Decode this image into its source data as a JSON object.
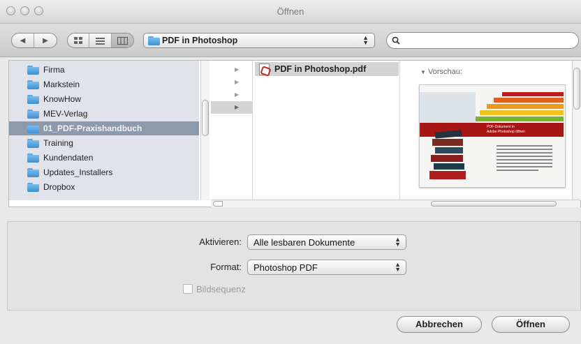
{
  "window": {
    "title": "Öffnen"
  },
  "toolbar": {
    "nav_back_icon": "◀",
    "nav_forward_icon": "▶",
    "location": "PDF in Photoshop",
    "search_placeholder": ""
  },
  "sidebar": {
    "items": [
      {
        "label": "Firma"
      },
      {
        "label": "Markstein"
      },
      {
        "label": "KnowHow"
      },
      {
        "label": "MEV-Verlag"
      },
      {
        "label": "01_PDF-Praxishandbuch",
        "selected": true
      },
      {
        "label": "Training"
      },
      {
        "label": "Kundendaten"
      },
      {
        "label": "Updates_Installers"
      },
      {
        "label": "Dropbox"
      }
    ]
  },
  "files": {
    "selected_file": "PDF in Photoshop.pdf",
    "preview_label": "Vorschau:",
    "preview_icon": "▼"
  },
  "thumb": {
    "line1": "PDF-Dokument in",
    "line2": "Adobe Photoshop öffnen"
  },
  "options": {
    "activate_label": "Aktivieren:",
    "activate_value": "Alle lesbaren Dokumente",
    "format_label": "Format:",
    "format_value": "Photoshop PDF",
    "sequence_label": "Bildsequenz"
  },
  "buttons": {
    "cancel": "Abbrechen",
    "open": "Öffnen"
  }
}
